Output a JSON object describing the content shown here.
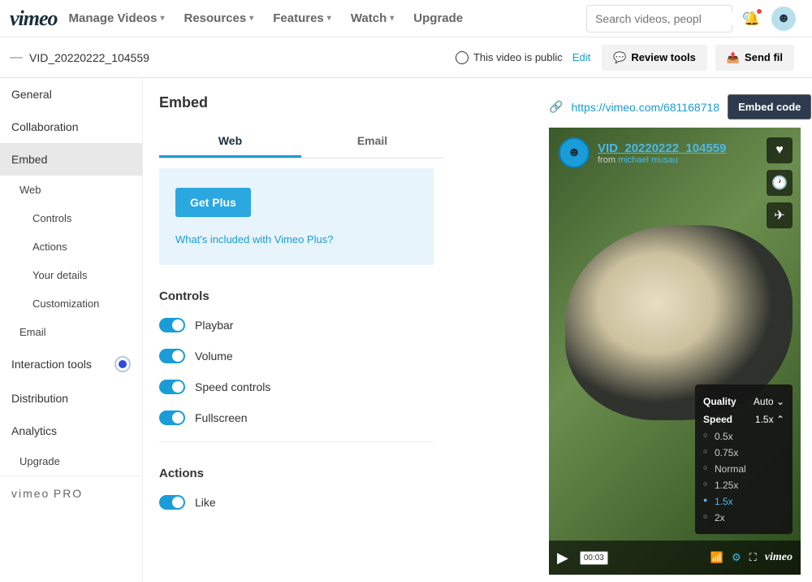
{
  "topnav": {
    "logo": "vimeo",
    "items": [
      "Manage Videos",
      "Resources",
      "Features",
      "Watch",
      "Upgrade"
    ],
    "search_placeholder": "Search videos, peopl"
  },
  "subheader": {
    "crumb": "VID_20220222_104559",
    "privacy_text": "This video is public",
    "edit_label": "Edit",
    "review_label": "Review tools",
    "send_label": "Send fil"
  },
  "sidebar": {
    "general": "General",
    "collaboration": "Collaboration",
    "embed": "Embed",
    "web": "Web",
    "controls": "Controls",
    "actions": "Actions",
    "your_details": "Your details",
    "customization": "Customization",
    "email": "Email",
    "interaction": "Interaction tools",
    "distribution": "Distribution",
    "analytics": "Analytics",
    "upgrade": "Upgrade",
    "pro_logo": "vimeo",
    "pro_text": "PRO"
  },
  "embed": {
    "title": "Embed",
    "tabs": {
      "web": "Web",
      "email": "Email"
    },
    "promo": {
      "cta": "Get Plus",
      "link": "What's included with Vimeo Plus?"
    },
    "controls_title": "Controls",
    "toggles": {
      "playbar": "Playbar",
      "volume": "Volume",
      "speed": "Speed controls",
      "fullscreen": "Fullscreen"
    },
    "actions_title": "Actions",
    "like": "Like"
  },
  "preview": {
    "url": "https://vimeo.com/681168718",
    "embed_btn": "Embed code",
    "video_title": "VID_20220222_104559",
    "from_prefix": "from ",
    "author": "michael musau",
    "menu": {
      "quality_label": "Quality",
      "quality_value": "Auto",
      "speed_label": "Speed",
      "speed_value": "1.5x",
      "options": [
        "0.5x",
        "0.75x",
        "Normal",
        "1.25x",
        "1.5x",
        "2x"
      ],
      "selected": "1.5x"
    },
    "time": "00:03",
    "logo": "vimeo"
  }
}
